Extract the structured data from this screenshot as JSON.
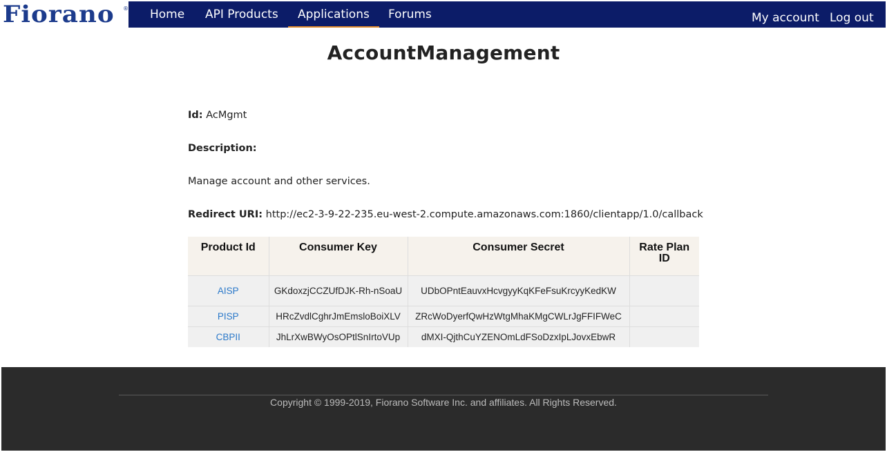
{
  "header": {
    "logo_text": "Fiorano",
    "logo_mark": "®",
    "nav": [
      {
        "label": "Home"
      },
      {
        "label": "API Products"
      },
      {
        "label": "Applications",
        "active": true
      },
      {
        "label": "Forums"
      }
    ],
    "my_account": "My account",
    "log_out": "Log out",
    "colors": {
      "nav_bg": "#0c1c68",
      "active_underline": "#e08a2c",
      "logo": "#1c3b8c"
    }
  },
  "app": {
    "title": "AccountManagement",
    "id_label": "Id:",
    "id_value": "AcMgmt",
    "description_label": "Description:",
    "description": "Manage account and other services.",
    "redirect_label": "Redirect URI:",
    "redirect_uri": "http://ec2-3-9-22-235.eu-west-2.compute.amazonaws.com:1860/clientapp/1.0/callback"
  },
  "keys_table": {
    "headers": [
      "Product Id",
      "Consumer Key",
      "Consumer Secret",
      "Rate Plan ID"
    ],
    "rows": [
      {
        "product": "AISP",
        "key": "GKdoxzjCCZUfDJK-Rh-nSoaU",
        "secret": "UDbOPntEauvxHcvgyyKqKFeFsuKrcyyKedKW",
        "rate_plan": ""
      },
      {
        "product": "PISP",
        "key": "HRcZvdlCghrJmEmsloBoiXLV",
        "secret": "ZRcWoDyerfQwHzWtgMhaKMgCWLrJgFFIFWeC",
        "rate_plan": ""
      },
      {
        "product": "CBPII",
        "key": "JhLrXwBWyOsOPtlSnIrtoVUp",
        "secret": "dMXI-QjthCuYZENOmLdFSoDzxIpLJovxEbwR",
        "rate_plan": ""
      }
    ]
  },
  "footer": {
    "copyright": "Copyright © 1999-2019, Fiorano Software Inc. and affiliates. All Rights Reserved."
  }
}
